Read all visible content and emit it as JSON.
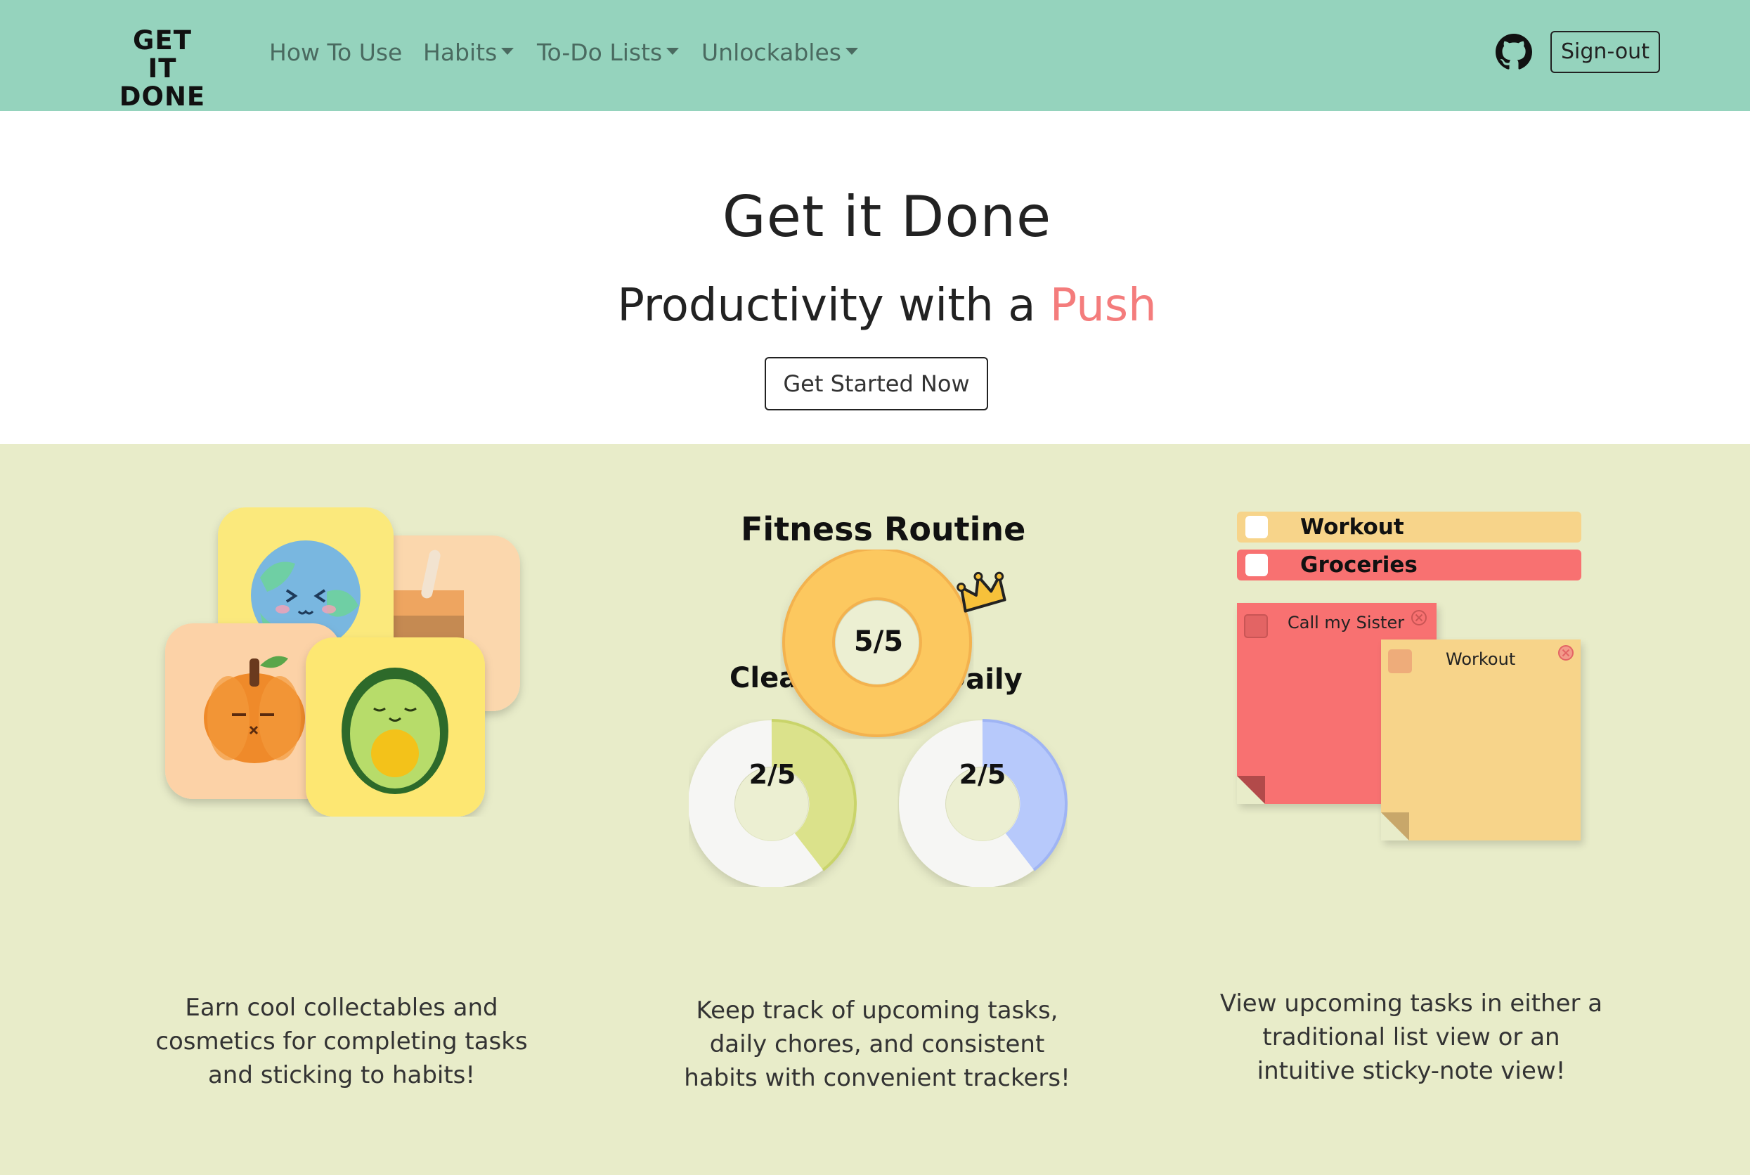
{
  "navbar": {
    "logo_line1": "GET IT",
    "logo_line2": "DONE",
    "links": [
      {
        "label": "How To Use"
      },
      {
        "label": "Habits"
      },
      {
        "label": "To-Do Lists"
      },
      {
        "label": "Unlockables"
      }
    ],
    "signout_label": "Sign-out",
    "bg_color": "#95d3bd"
  },
  "hero": {
    "title": "Get it Done",
    "subtitle_prefix": "Productivity with a ",
    "subtitle_accent": "Push",
    "accent_color": "#f47c7c",
    "cta_label": "Get Started Now"
  },
  "features": {
    "bg_color": "#e8ecc9",
    "collectables": {
      "description_lines": [
        "Earn cool collectables and",
        "cosmetics for completing tasks",
        "and sticking to habits!"
      ]
    },
    "habits": {
      "routine_title": "Fitness Routine",
      "main_progress": "5/5",
      "clean_label": "Clean",
      "clean_progress": "2/5",
      "daily_label": "Daily",
      "daily_progress": "2/5",
      "description_lines": [
        "Keep track of upcoming tasks,",
        "daily chores, and consistent",
        "habits with convenient trackers!"
      ]
    },
    "todo": {
      "list_items": [
        {
          "label": "Workout"
        },
        {
          "label": "Groceries"
        }
      ],
      "sticky_notes": [
        {
          "label": "Call my Sister"
        },
        {
          "label": "Workout"
        }
      ],
      "description_lines": [
        "View upcoming tasks in either a",
        "traditional list view or an",
        "intuitive sticky-note view!"
      ]
    }
  }
}
